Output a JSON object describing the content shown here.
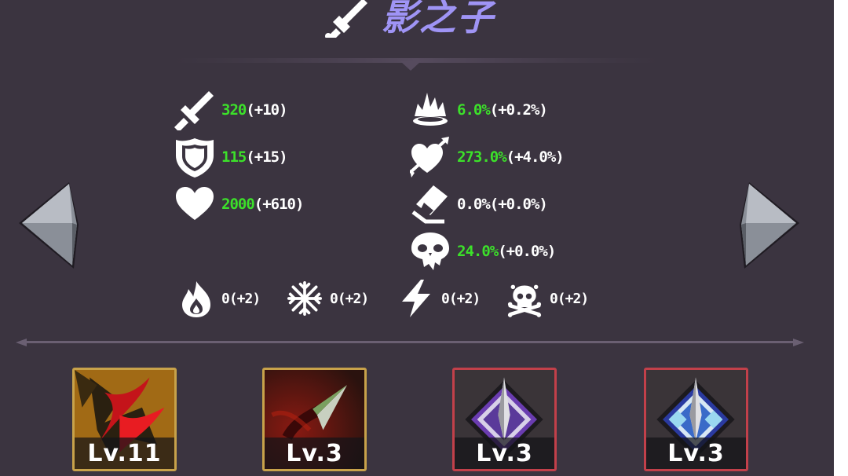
{
  "hero": {
    "name": "影之子",
    "icon": "dagger-icon"
  },
  "stats_left": [
    {
      "icon": "sword-icon",
      "value": "320",
      "bonus": "(+10)",
      "color": "#3ce02a"
    },
    {
      "icon": "shield-icon",
      "value": "115",
      "bonus": "(+15)",
      "color": "#3ce02a"
    },
    {
      "icon": "heart-icon",
      "value": "2000",
      "bonus": "(+610)",
      "color": "#3ce02a"
    }
  ],
  "stats_right": [
    {
      "icon": "crit-burst-icon",
      "value": "6.0%",
      "bonus": "(+0.2%)",
      "color": "#3ce02a"
    },
    {
      "icon": "pierced-heart-icon",
      "value": "273.0%",
      "bonus": "(+4.0%)",
      "color": "#3ce02a"
    },
    {
      "icon": "eraser-icon",
      "value": "0.0%",
      "bonus": "(+0.0%)",
      "color": "#ffffff"
    },
    {
      "icon": "skull-drip-icon",
      "value": "24.0%",
      "bonus": "(+0.0%)",
      "color": "#3ce02a"
    }
  ],
  "resistances": [
    {
      "icon": "fire-icon",
      "text": "0(+2)"
    },
    {
      "icon": "snowflake-icon",
      "text": "0(+2)"
    },
    {
      "icon": "lightning-icon",
      "text": "0(+2)"
    },
    {
      "icon": "skull-crossbones-icon",
      "text": "0(+2)"
    }
  ],
  "nav": {
    "prev": "left-arrow-icon",
    "next": "right-arrow-icon"
  },
  "skills": [
    {
      "level": "Lv.11",
      "frame": "gold"
    },
    {
      "level": "Lv.3",
      "frame": "gold"
    },
    {
      "level": "Lv.3",
      "frame": "red"
    },
    {
      "level": "Lv.3",
      "frame": "red"
    }
  ]
}
